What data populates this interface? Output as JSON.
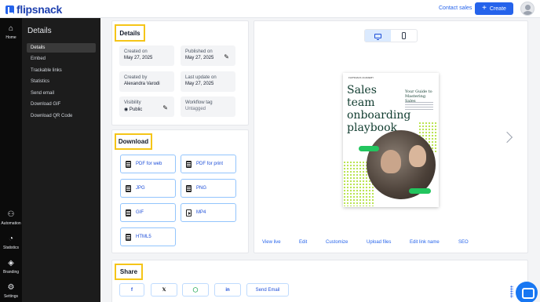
{
  "header": {
    "logo_text": "flipsnack",
    "contact_label": "Contact sales",
    "create_label": "Create"
  },
  "rail": {
    "items": [
      {
        "label": "Home",
        "icon": "home-icon"
      },
      {
        "label": "Automation",
        "icon": "automation-icon"
      },
      {
        "label": "Statistics",
        "icon": "statistics-icon"
      },
      {
        "label": "Branding",
        "icon": "branding-icon"
      },
      {
        "label": "Settings",
        "icon": "settings-icon"
      }
    ]
  },
  "subnav": {
    "title": "Details",
    "items": [
      {
        "label": "Details"
      },
      {
        "label": "Embed"
      },
      {
        "label": "Trackable links"
      },
      {
        "label": "Statistics"
      },
      {
        "label": "Send email"
      },
      {
        "label": "Download GIF"
      },
      {
        "label": "Download QR Code"
      }
    ]
  },
  "details": {
    "title": "Details",
    "created_on": {
      "label": "Created on",
      "value": "May 27, 2025"
    },
    "published_on": {
      "label": "Published on",
      "value": "May 27, 2025"
    },
    "created_by": {
      "label": "Created by",
      "value": "Alexandra Varodi"
    },
    "last_update": {
      "label": "Last update on",
      "value": "May 27, 2025"
    },
    "visibility": {
      "label": "Visibility",
      "value": "Public"
    },
    "workflow": {
      "label": "Workflow tag",
      "value": "Untagged"
    }
  },
  "download": {
    "title": "Download",
    "buttons": [
      {
        "label": "PDF for web"
      },
      {
        "label": "PDF for print"
      },
      {
        "label": "JPG"
      },
      {
        "label": "PNG"
      },
      {
        "label": "GIF"
      },
      {
        "label": "MP4"
      },
      {
        "label": "HTML5"
      }
    ]
  },
  "preview": {
    "book_brand": "FLIPSNACK ACADEMY",
    "book_title": "Sales team onboarding playbook",
    "book_subtitle": "Your Guide to Mastering Sales",
    "actions": [
      "View live",
      "Edit",
      "Customize",
      "Upload files",
      "Edit link name",
      "SEO"
    ]
  },
  "share": {
    "title": "Share",
    "buttons": [
      {
        "icon": "facebook-icon",
        "glyph": "f"
      },
      {
        "icon": "x-icon",
        "glyph": "𝕏"
      },
      {
        "icon": "whatsapp-icon",
        "glyph": "◯"
      },
      {
        "icon": "linkedin-icon",
        "glyph": "in"
      },
      {
        "label": "Send Email"
      }
    ]
  },
  "colors": {
    "accent": "#2563eb",
    "highlight": "#f5c518",
    "sidebar": "#1c1c1c",
    "rail": "#0b0b0b"
  }
}
